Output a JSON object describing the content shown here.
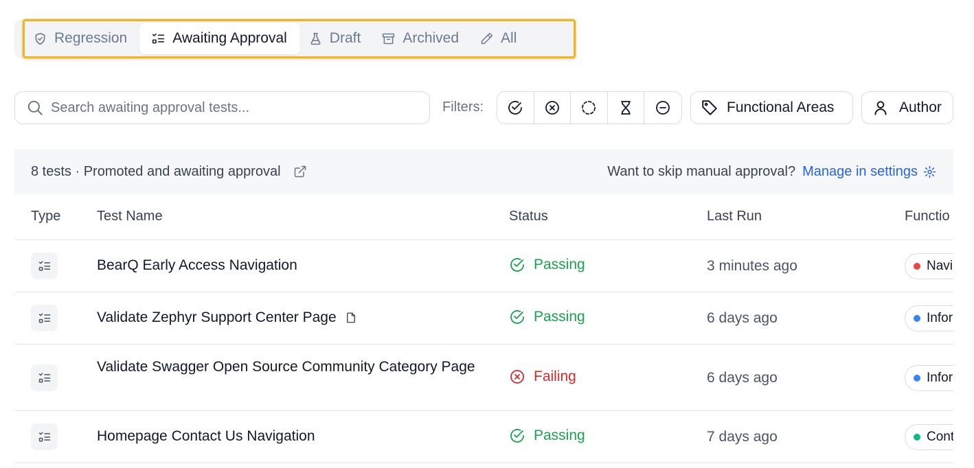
{
  "tabs": [
    {
      "label": "Regression",
      "icon": "shield-check-icon",
      "active": false
    },
    {
      "label": "Awaiting Approval",
      "icon": "checklist-icon",
      "active": true
    },
    {
      "label": "Draft",
      "icon": "flask-icon",
      "active": false
    },
    {
      "label": "Archived",
      "icon": "archive-icon",
      "active": false
    },
    {
      "label": "All",
      "icon": "pencil-icon",
      "active": false
    }
  ],
  "search": {
    "placeholder": "Search awaiting approval tests..."
  },
  "filters": {
    "label": "Filters:",
    "status_buttons": [
      "passing-filter-icon",
      "failing-filter-icon",
      "pending-filter-icon",
      "running-filter-icon",
      "skipped-filter-icon"
    ],
    "functional_areas_label": "Functional Areas",
    "author_label": "Author"
  },
  "info_bar": {
    "summary": "8 tests · Promoted and awaiting approval",
    "prompt": "Want to skip manual approval?",
    "settings_link": "Manage in settings"
  },
  "table": {
    "headers": [
      "Type",
      "Test Name",
      "Status",
      "Last Run",
      "Functio"
    ],
    "rows": [
      {
        "name": "BearQ Early Access Navigation",
        "status": "Passing",
        "last_run": "3 minutes ago",
        "area": "Navi",
        "area_color": "#ef4444"
      },
      {
        "name": "Validate Zephyr Support Center Page",
        "status": "Passing",
        "last_run": "6 days ago",
        "area": "Infor",
        "area_color": "#3b82f6"
      },
      {
        "name": "Validate Swagger Open Source Community Category Page",
        "status": "Failing",
        "last_run": "6 days ago",
        "area": "Infor",
        "area_color": "#3b82f6"
      },
      {
        "name": "Homepage Contact Us Navigation",
        "status": "Passing",
        "last_run": "7 days ago",
        "area": "Cont",
        "area_color": "#10b981"
      }
    ]
  },
  "colors": {
    "accent": "#2563eb",
    "pass": "#16a34a",
    "fail": "#dc2626",
    "highlight": "#f0b429"
  }
}
